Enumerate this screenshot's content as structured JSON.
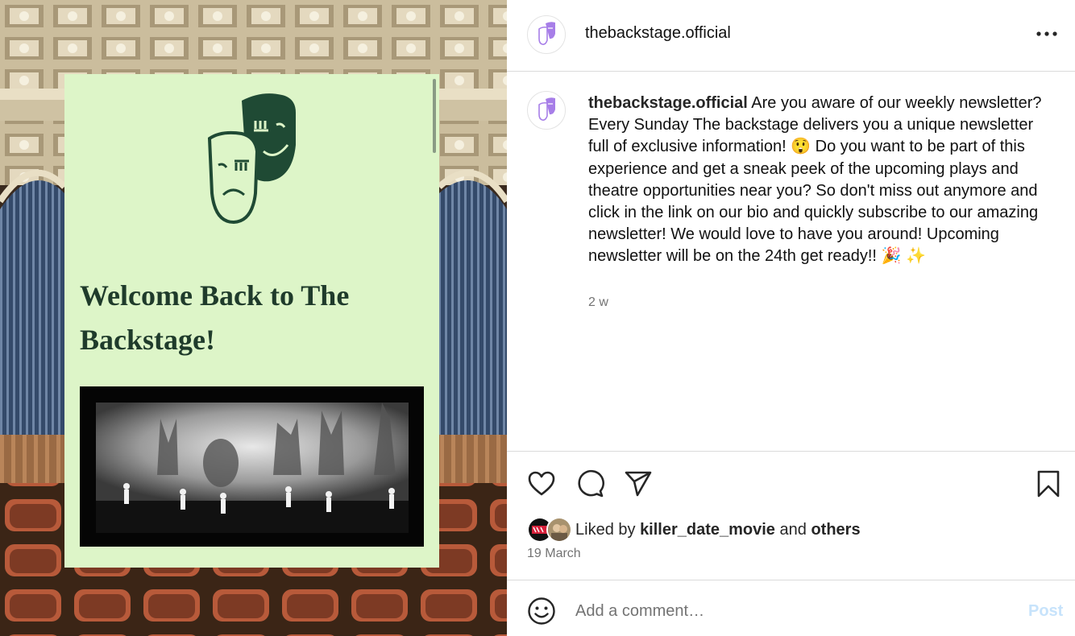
{
  "post": {
    "username": "thebackstage.official",
    "caption_text": "Are you aware of our weekly newsletter? Every Sunday The backstage delivers you a unique newsletter full of exclusive information! 😲 Do you want to be part of this experience and get a sneak peek of the upcoming plays and theatre opportunities near you? So don't miss out anymore and click in the link on our bio and quickly subscribe to our amazing newsletter! We would love to have you around! Upcoming newsletter will be on the 24th get ready!! 🎉 ✨",
    "time_ago": "2 w",
    "date": "19 March",
    "liked_by_prefix": "Liked by",
    "liked_by_user": "killer_date_movie",
    "liked_by_and": "and",
    "liked_by_others": "others"
  },
  "poster": {
    "headline": "Welcome Back to The Backstage!"
  },
  "comment": {
    "placeholder": "Add a comment…",
    "post_label": "Post"
  },
  "icons": {
    "more": "more-horizontal-icon",
    "like": "heart-icon",
    "comment": "comment-bubble-icon",
    "share": "paper-plane-icon",
    "save": "bookmark-icon",
    "emoji": "smiley-icon"
  },
  "colors": {
    "poster_bg": "#ddf5c8",
    "poster_text": "#1f3b2b",
    "brand_purple": "#a77ee8",
    "post_button_disabled": "#c7e3fb",
    "divider": "#dbdbdb",
    "secondary_text": "#737373"
  }
}
